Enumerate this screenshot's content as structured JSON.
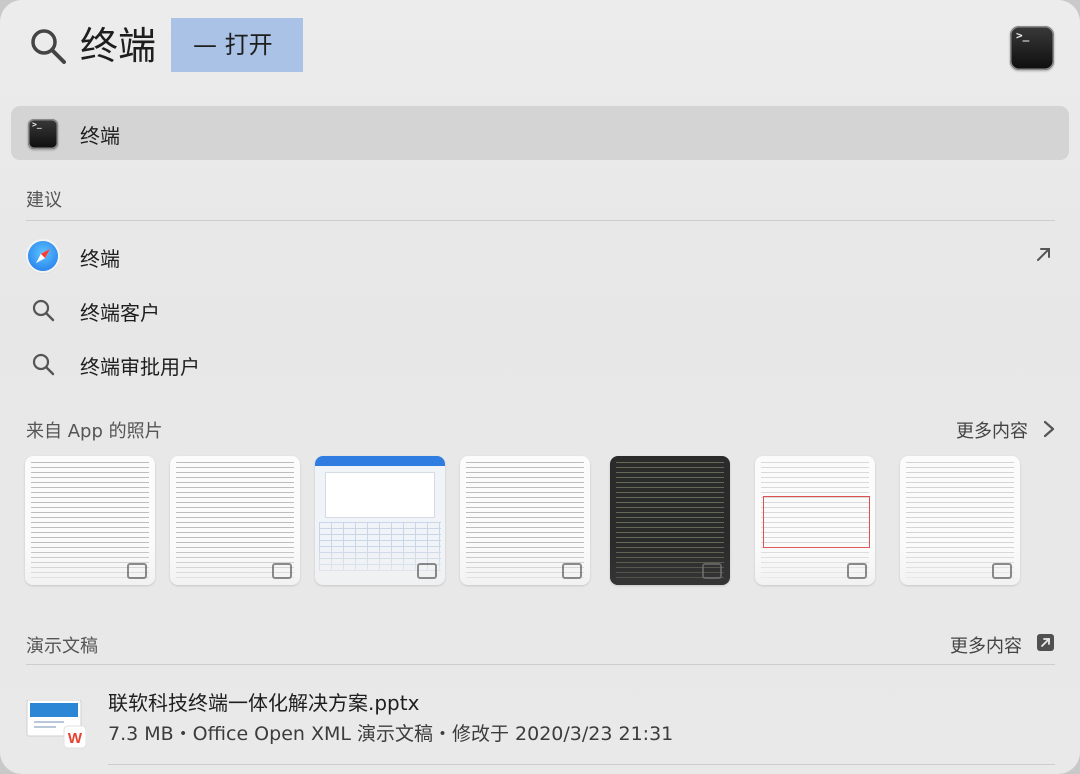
{
  "search": {
    "query": "终端",
    "completion": "— 打开",
    "icon": "search-icon"
  },
  "top_hit": {
    "label": "终端",
    "icon": "terminal-icon"
  },
  "suggestions": {
    "title": "建议",
    "items": [
      {
        "label": "终端",
        "icon": "safari-icon",
        "action_icon": "arrow-up-right-icon"
      },
      {
        "label": "终端客户",
        "icon": "search-icon"
      },
      {
        "label": "终端审批用户",
        "icon": "search-icon"
      }
    ]
  },
  "photos": {
    "title": "来自 App 的照片",
    "more": "更多内容",
    "more_icon": "chevron-right-icon",
    "count": 7
  },
  "documents": {
    "title": "演示文稿",
    "more": "更多内容",
    "more_icon": "open-external-icon",
    "items": [
      {
        "name": "联软科技终端一体化解决方案.pptx",
        "meta": "7.3 MB・Office Open XML 演示文稿・修改于 2020/3/23 21:31",
        "icon": "wps-presentation-icon"
      }
    ]
  },
  "colors": {
    "completion_highlight": "#a9c2e6",
    "selected_row": "#d4d4d4",
    "wps_red": "#e8412f"
  }
}
